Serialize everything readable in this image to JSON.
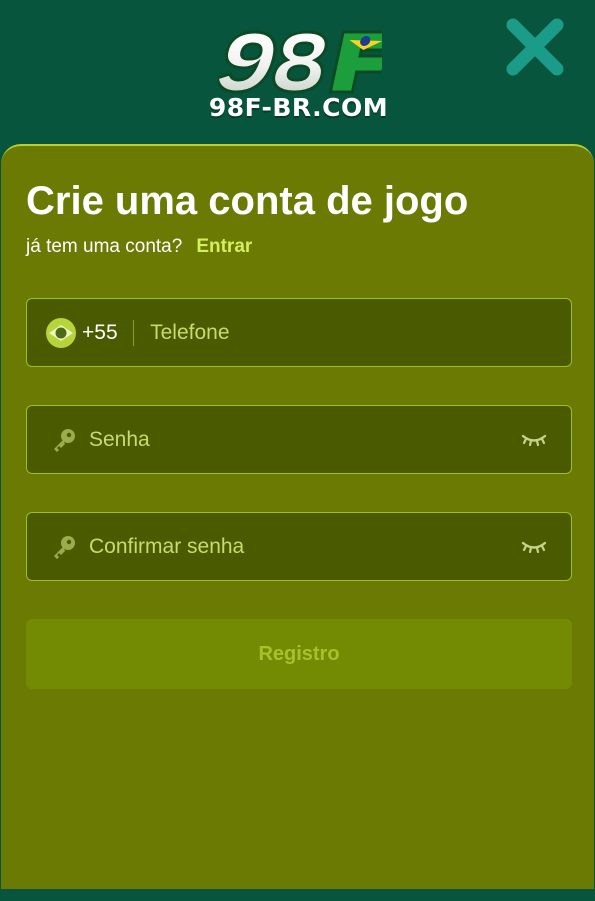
{
  "header": {
    "logo_domain": "98F-BR.COM",
    "close_icon": "close-icon"
  },
  "form": {
    "title": "Crie uma conta de jogo",
    "has_account_text": "já tem uma conta?",
    "login_link": "Entrar",
    "phone": {
      "country_flag": "brazil-flag-icon",
      "country_code": "+55",
      "placeholder": "Telefone",
      "value": ""
    },
    "password": {
      "icon": "key-icon",
      "placeholder": "Senha",
      "value": "",
      "toggle_icon": "eye-closed-icon"
    },
    "confirm_password": {
      "icon": "key-icon",
      "placeholder": "Confirmar senha",
      "value": "",
      "toggle_icon": "eye-closed-icon"
    },
    "submit_label": "Registro"
  },
  "colors": {
    "header_bg": "#07553c",
    "panel_bg": "#6a7a02",
    "field_bg": "#4a5a01",
    "field_border": "#9fbe22",
    "accent": "#d4f05a",
    "button_bg": "#738b03",
    "button_text": "#a7c12b",
    "close_icon": "#1a9c88"
  }
}
